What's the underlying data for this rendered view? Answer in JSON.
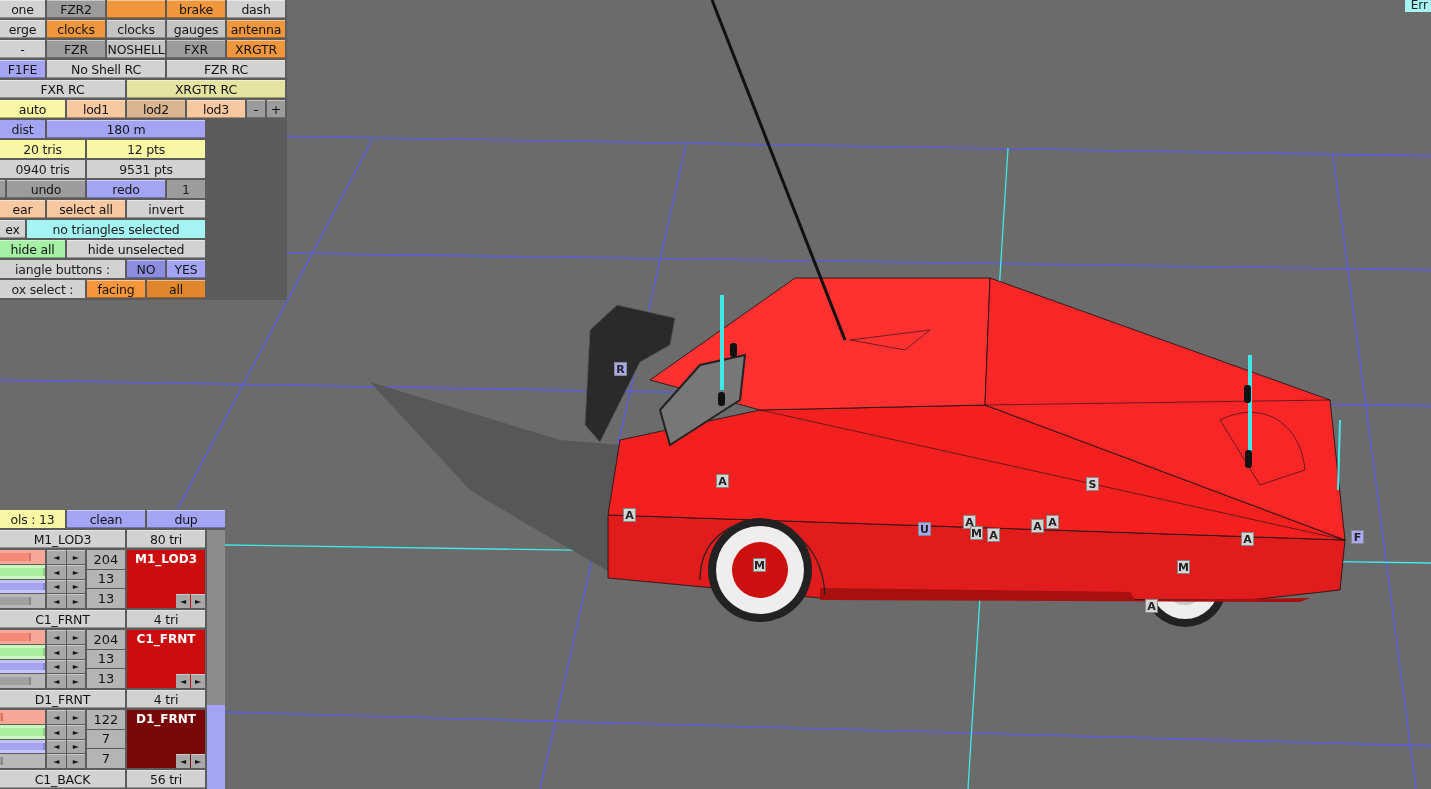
{
  "top_panel": {
    "rows": [
      [
        {
          "label": "one",
          "kind": "button",
          "color": "#d2d2d2"
        },
        {
          "label": "FZR2",
          "kind": "button",
          "color": "#9c9c9c"
        },
        {
          "kind": "button",
          "color": "#f0963c"
        },
        {
          "label": "brake",
          "kind": "button",
          "color": "#f0963c"
        },
        {
          "label": "dash",
          "kind": "button",
          "color": "#d2d2d2"
        }
      ],
      [
        {
          "label": "erge",
          "kind": "button",
          "color": "#d2d2d2"
        },
        {
          "label": "clocks",
          "kind": "button",
          "color": "#f0963c"
        },
        {
          "label": "clocks",
          "kind": "button",
          "color": "#c4c4c4"
        },
        {
          "label": "gauges",
          "kind": "button",
          "color": "#c4c4c4"
        },
        {
          "label": "antenna",
          "kind": "button",
          "color": "#f0963c"
        }
      ],
      [
        {
          "label": "-",
          "kind": "button",
          "color": "#d2d2d2"
        },
        {
          "label": "FZR",
          "kind": "button",
          "color": "#9c9c9c"
        },
        {
          "label": "NOSHELL",
          "kind": "button",
          "color": "#c4c4c4"
        },
        {
          "label": "FXR",
          "kind": "button",
          "color": "#9c9c9c"
        },
        {
          "label": "XRGTR",
          "kind": "button",
          "color": "#f0963c"
        }
      ],
      [
        {
          "label": "F1FE",
          "kind": "button",
          "color": "#a4a4f4"
        },
        {
          "label": "No Shell RC",
          "kind": "button",
          "color": "#d2d2d2"
        },
        {
          "label": "FZR RC",
          "kind": "button",
          "color": "#d2d2d2"
        }
      ],
      [
        {
          "label": "FXR RC",
          "kind": "button",
          "color": "#d2d2d2"
        },
        {
          "label": "XRGTR RC",
          "kind": "button",
          "color": "#e4e4a0"
        }
      ],
      [
        {
          "label": "auto",
          "kind": "button",
          "color": "#f8f8a4"
        },
        {
          "label": "lod1",
          "kind": "button",
          "color": "#f8c8a0"
        },
        {
          "label": "lod2",
          "kind": "button",
          "color": "#d8b490"
        },
        {
          "label": "lod3",
          "kind": "button",
          "color": "#f8c8a0"
        },
        {
          "label": "-",
          "kind": "button",
          "color": "#9c9c9c"
        },
        {
          "label": "+",
          "kind": "button",
          "color": "#9c9c9c"
        }
      ],
      [
        {
          "label": "dist",
          "kind": "label",
          "color": "#a4a4f4"
        },
        {
          "label": "180 m",
          "kind": "button",
          "color": "#a4a4f4"
        }
      ],
      [
        {
          "label": "20 tris",
          "kind": "label",
          "color": "#f8f8a4"
        },
        {
          "label": "12 pts",
          "kind": "label",
          "color": "#f8f8a4"
        }
      ],
      [
        {
          "label": "0940 tris",
          "kind": "label",
          "color": "#d2d2d2"
        },
        {
          "label": "9531 pts",
          "kind": "label",
          "color": "#d2d2d2"
        }
      ],
      [
        {
          "kind": "button",
          "color": "#9c9c9c"
        },
        {
          "label": "undo",
          "kind": "button",
          "color": "#9c9c9c"
        },
        {
          "label": "redo",
          "kind": "button",
          "color": "#a4a4f4"
        },
        {
          "label": "1",
          "kind": "label",
          "color": "#9c9c9c"
        }
      ],
      [
        {
          "label": "ear",
          "kind": "button",
          "color": "#f8c8a0"
        },
        {
          "label": "select all",
          "kind": "button",
          "color": "#f8c8a0"
        },
        {
          "label": "invert",
          "kind": "button",
          "color": "#d2d2d2"
        }
      ],
      [
        {
          "label": "ex",
          "kind": "button",
          "color": "#d2d2d2"
        },
        {
          "label": "no triangles selected",
          "kind": "label",
          "color": "#a4f4f4"
        }
      ],
      [
        {
          "label": "hide all",
          "kind": "button",
          "color": "#a4f0a4"
        },
        {
          "label": "hide unselected",
          "kind": "button",
          "color": "#d2d2d2"
        }
      ],
      [
        {
          "label": "iangle buttons :",
          "kind": "label",
          "color": "#d2d2d2"
        },
        {
          "label": "NO",
          "kind": "button",
          "color": "#8c8ce0"
        },
        {
          "label": "YES",
          "kind": "button",
          "color": "#a4a4f4"
        }
      ],
      [
        {
          "label": "ox select :",
          "kind": "label",
          "color": "#d2d2d2"
        },
        {
          "label": "facing",
          "kind": "button",
          "color": "#f8963c"
        },
        {
          "label": "all",
          "kind": "button",
          "color": "#e0862c"
        }
      ]
    ]
  },
  "bottom_panel": {
    "header": [
      {
        "label": "ols : 13",
        "kind": "label",
        "color": "#f8f8a4"
      },
      {
        "label": "clean",
        "kind": "button",
        "color": "#a4a4f4"
      },
      {
        "label": "dup",
        "kind": "button",
        "color": "#a4a4f4"
      }
    ],
    "materials": [
      {
        "name": "M1_LOD3",
        "tri_count": "80 tri",
        "color": "#cc0d0d",
        "swatch_label": "M1_LOD3",
        "values": [
          "204",
          "13",
          "13"
        ],
        "swatch_arrows": [
          "◄",
          "►"
        ],
        "sliders": [
          {
            "kind": "red",
            "level": 0.68,
            "arrows": [
              "◄",
              "►"
            ]
          },
          {
            "kind": "green",
            "level": 1,
            "arrows": [
              "◄",
              "►"
            ]
          },
          {
            "kind": "blue",
            "level": 1,
            "arrows": [
              "◄",
              "►"
            ]
          },
          {
            "kind": "grey",
            "level": 0.68,
            "arrows": [
              "◄",
              "►"
            ]
          }
        ]
      },
      {
        "name": "C1_FRNT",
        "tri_count": "4 tri",
        "color": "#cc0d0d",
        "swatch_label": "C1_FRNT",
        "values": [
          "204",
          "13",
          "13"
        ],
        "swatch_arrows": [
          "◄",
          "►"
        ],
        "sliders": [
          {
            "kind": "red",
            "level": 0.68,
            "arrows": [
              "◄",
              "►"
            ]
          },
          {
            "kind": "green",
            "level": 1,
            "arrows": [
              "◄",
              "►"
            ]
          },
          {
            "kind": "blue",
            "level": 1,
            "arrows": [
              "◄",
              "►"
            ]
          },
          {
            "kind": "grey",
            "level": 0.68,
            "arrows": [
              "◄",
              "►"
            ]
          }
        ]
      },
      {
        "name": "D1_FRNT",
        "tri_count": "4 tri",
        "color": "#7a0707",
        "swatch_label": "D1_FRNT",
        "values": [
          "122",
          "7",
          "7"
        ],
        "swatch_arrows": [
          "◄",
          "►"
        ],
        "sliders": [
          {
            "kind": "red",
            "level": 0.06,
            "arrows": [
              "◄",
              "►"
            ]
          },
          {
            "kind": "green",
            "level": 1,
            "arrows": [
              "◄",
              "►"
            ]
          },
          {
            "kind": "blue",
            "level": 1,
            "arrows": [
              "◄",
              "►"
            ]
          },
          {
            "kind": "grey",
            "level": 0.06,
            "arrows": [
              "◄",
              "►"
            ]
          }
        ]
      },
      {
        "name": "C1_BACK",
        "tri_count": "56 tri"
      }
    ]
  },
  "error_button": {
    "label": "Err"
  },
  "markers": [
    {
      "label": "R",
      "color": "#a8a8f4"
    },
    {
      "label": "A",
      "color": "#d4d4d4"
    },
    {
      "label": "S",
      "color": "#d4d4d4"
    },
    {
      "label": "A",
      "color": "#d4d4d4"
    },
    {
      "label": "U",
      "color": "#a8a8f4"
    },
    {
      "label": "A",
      "color": "#d4d4d4"
    },
    {
      "label": "M",
      "color": "#d4d4d4"
    },
    {
      "label": "A",
      "color": "#d4d4d4"
    },
    {
      "label": "A",
      "color": "#d4d4d4"
    },
    {
      "label": "A",
      "color": "#d4d4d4"
    },
    {
      "label": "A",
      "color": "#d4d4d4"
    },
    {
      "label": "F",
      "color": "#a8a8f4"
    },
    {
      "label": "M",
      "color": "#d4d4d4"
    },
    {
      "label": "M",
      "color": "#d4d4d4"
    },
    {
      "label": "A",
      "color": "#d4d4d4"
    }
  ]
}
